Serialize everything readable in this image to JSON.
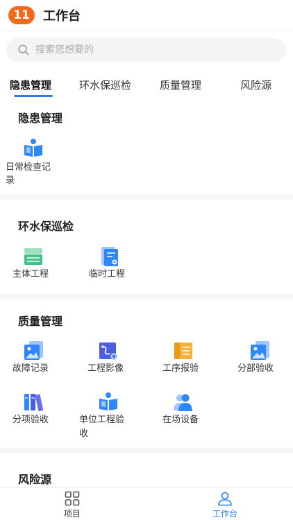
{
  "header": {
    "badge": "11",
    "title": "工作台"
  },
  "search": {
    "placeholder": "搜索您想要的"
  },
  "tabs": [
    {
      "label": "隐患管理",
      "active": true
    },
    {
      "label": "环水保巡检",
      "active": false
    },
    {
      "label": "质量管理",
      "active": false
    },
    {
      "label": "风险源",
      "active": false
    }
  ],
  "sections": {
    "hazard": {
      "title": "隐患管理",
      "items": [
        {
          "label_line1": "日常检查记",
          "label_line2": "录",
          "icon": "book-icon"
        }
      ]
    },
    "env": {
      "title": "环水保巡检",
      "items": [
        {
          "label": "主体工程",
          "icon": "server-icon"
        },
        {
          "label": "临时工程",
          "icon": "document-gear-icon"
        }
      ]
    },
    "quality": {
      "title": "质量管理",
      "items": [
        {
          "label": "故障记录",
          "icon": "image-doc-icon"
        },
        {
          "label": "工程影像",
          "icon": "route-gear-icon"
        },
        {
          "label": "工序报验",
          "icon": "folder-icon"
        },
        {
          "label": "分部验收",
          "icon": "image-doc-icon"
        },
        {
          "label": "分项验收",
          "icon": "binders-icon"
        },
        {
          "label_line1": "单位工程验",
          "label_line2": "收",
          "icon": "book-icon"
        },
        {
          "label": "在场设备",
          "icon": "people-icon"
        }
      ]
    },
    "risk": {
      "title": "风险源"
    }
  },
  "bottom_nav": [
    {
      "label": "项目",
      "icon": "grid-icon",
      "active": false
    },
    {
      "label": "工作台",
      "icon": "user-icon",
      "active": true
    }
  ],
  "colors": {
    "accent": "#2b7bf0",
    "badge": "#f26a1b",
    "icon_blue": "#2f86f6",
    "icon_light": "#9fc6fb",
    "icon_green": "#3fc48a",
    "icon_yellow": "#f6b33c"
  }
}
